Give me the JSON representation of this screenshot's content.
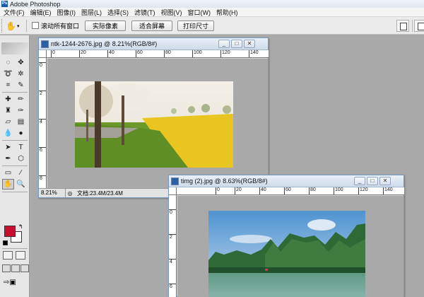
{
  "app": {
    "title": "Adobe Photoshop",
    "logo_text": "Ps"
  },
  "menu": [
    "文件(F)",
    "编辑(E)",
    "图像(I)",
    "图层(L)",
    "选择(S)",
    "滤镜(T)",
    "视图(V)",
    "窗口(W)",
    "帮助(H)"
  ],
  "options": {
    "tool_icon": "hand-icon",
    "scroll_all_label": "滚动所有窗口",
    "scroll_all_checked": false,
    "buttons": [
      "实际像素",
      "适合屏幕",
      "打印尺寸"
    ]
  },
  "colors": {
    "foreground": "#c8102e",
    "background": "#ffffff"
  },
  "windows": [
    {
      "title": "ntk-1244-2676.jpg @ 8.21%(RGB/8#)",
      "ruler_h": [
        "0",
        "20",
        "40",
        "60",
        "80",
        "100",
        "120",
        "140"
      ],
      "ruler_v": [
        "0",
        "2",
        "4",
        "6",
        "8"
      ],
      "zoom": "8.21%",
      "doc_info": "文档:23.4M/23.4M",
      "btn_minimize": "_",
      "btn_restore": "□",
      "btn_close": "✕"
    },
    {
      "title": "timg (2).jpg @ 8.63%(RGB/8#)",
      "ruler_h": [
        "0",
        "20",
        "40",
        "60",
        "80",
        "100",
        "120",
        "140"
      ],
      "ruler_v": [
        "0",
        "2",
        "4",
        "6"
      ],
      "btn_minimize": "_",
      "btn_restore": "□",
      "btn_close": "✕"
    }
  ]
}
